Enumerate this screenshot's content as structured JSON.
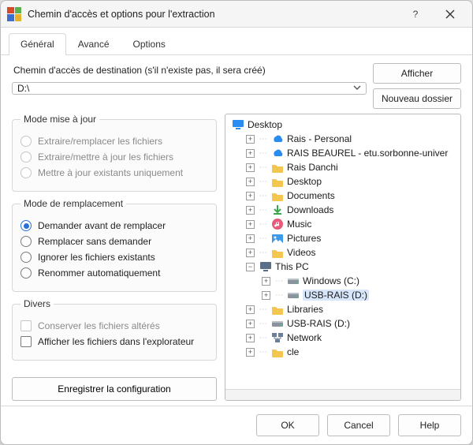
{
  "window": {
    "title": "Chemin d'accès et options pour l'extraction"
  },
  "tabs": {
    "general": "Général",
    "advanced": "Avancé",
    "options": "Options"
  },
  "path": {
    "label": "Chemin d'accès de destination (s'il n'existe pas, il sera créé)",
    "value": "D:\\"
  },
  "buttons": {
    "display": "Afficher",
    "new_folder": "Nouveau dossier",
    "save_config": "Enregistrer la configuration",
    "ok": "OK",
    "cancel": "Cancel",
    "help": "Help"
  },
  "groups": {
    "update_mode": {
      "legend": "Mode mise à jour",
      "opts": [
        "Extraire/remplacer les fichiers",
        "Extraire/mettre à jour les fichiers",
        "Mettre à jour existants uniquement"
      ]
    },
    "overwrite_mode": {
      "legend": "Mode de remplacement",
      "opts": [
        "Demander avant de remplacer",
        "Remplacer sans demander",
        "Ignorer les fichiers existants",
        "Renommer automatiquement"
      ]
    },
    "misc": {
      "legend": "Divers",
      "opts": [
        "Conserver les fichiers altérés",
        "Afficher les fichiers dans l'explorateur"
      ]
    }
  },
  "tree": {
    "root": "Desktop",
    "items": [
      {
        "label": "Rais - Personal",
        "icon": "cloud"
      },
      {
        "label": "RAIS BEAUREL - etu.sorbonne-univer",
        "icon": "cloud"
      },
      {
        "label": "Rais Danchi",
        "icon": "folder"
      },
      {
        "label": "Desktop",
        "icon": "folder"
      },
      {
        "label": "Documents",
        "icon": "folder"
      },
      {
        "label": "Downloads",
        "icon": "download"
      },
      {
        "label": "Music",
        "icon": "music"
      },
      {
        "label": "Pictures",
        "icon": "pictures"
      },
      {
        "label": "Videos",
        "icon": "folder"
      }
    ],
    "thispc": {
      "label": "This PC",
      "children": [
        {
          "label": "Windows (C:)",
          "icon": "drive"
        },
        {
          "label": "USB-RAIS (D:)",
          "icon": "drive",
          "selected": true
        }
      ]
    },
    "after": [
      {
        "label": "Libraries",
        "icon": "folder"
      },
      {
        "label": "USB-RAIS (D:)",
        "icon": "drive"
      },
      {
        "label": "Network",
        "icon": "network"
      },
      {
        "label": "cle",
        "icon": "folder"
      }
    ]
  }
}
